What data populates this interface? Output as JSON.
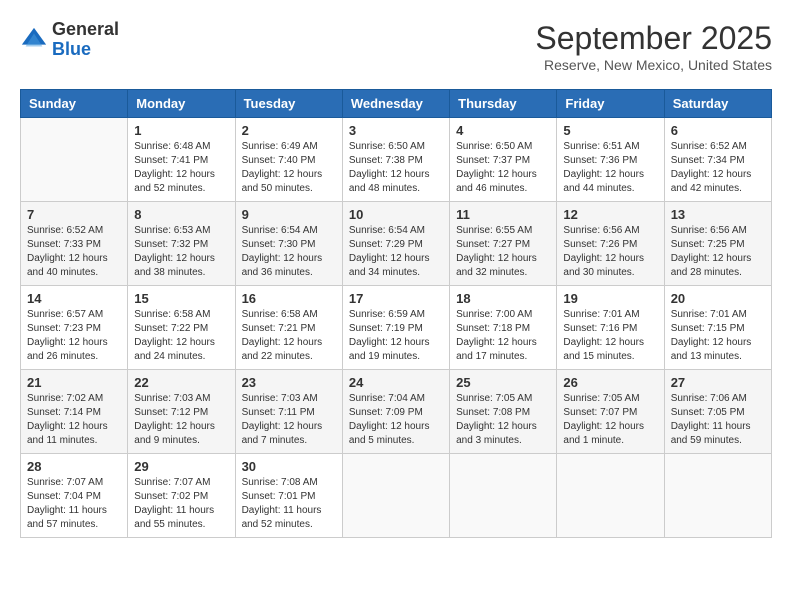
{
  "header": {
    "logo_general": "General",
    "logo_blue": "Blue",
    "month_title": "September 2025",
    "location": "Reserve, New Mexico, United States"
  },
  "days_of_week": [
    "Sunday",
    "Monday",
    "Tuesday",
    "Wednesday",
    "Thursday",
    "Friday",
    "Saturday"
  ],
  "weeks": [
    [
      {
        "day": "",
        "sunrise": "",
        "sunset": "",
        "daylight": ""
      },
      {
        "day": "1",
        "sunrise": "Sunrise: 6:48 AM",
        "sunset": "Sunset: 7:41 PM",
        "daylight": "Daylight: 12 hours and 52 minutes."
      },
      {
        "day": "2",
        "sunrise": "Sunrise: 6:49 AM",
        "sunset": "Sunset: 7:40 PM",
        "daylight": "Daylight: 12 hours and 50 minutes."
      },
      {
        "day": "3",
        "sunrise": "Sunrise: 6:50 AM",
        "sunset": "Sunset: 7:38 PM",
        "daylight": "Daylight: 12 hours and 48 minutes."
      },
      {
        "day": "4",
        "sunrise": "Sunrise: 6:50 AM",
        "sunset": "Sunset: 7:37 PM",
        "daylight": "Daylight: 12 hours and 46 minutes."
      },
      {
        "day": "5",
        "sunrise": "Sunrise: 6:51 AM",
        "sunset": "Sunset: 7:36 PM",
        "daylight": "Daylight: 12 hours and 44 minutes."
      },
      {
        "day": "6",
        "sunrise": "Sunrise: 6:52 AM",
        "sunset": "Sunset: 7:34 PM",
        "daylight": "Daylight: 12 hours and 42 minutes."
      }
    ],
    [
      {
        "day": "7",
        "sunrise": "Sunrise: 6:52 AM",
        "sunset": "Sunset: 7:33 PM",
        "daylight": "Daylight: 12 hours and 40 minutes."
      },
      {
        "day": "8",
        "sunrise": "Sunrise: 6:53 AM",
        "sunset": "Sunset: 7:32 PM",
        "daylight": "Daylight: 12 hours and 38 minutes."
      },
      {
        "day": "9",
        "sunrise": "Sunrise: 6:54 AM",
        "sunset": "Sunset: 7:30 PM",
        "daylight": "Daylight: 12 hours and 36 minutes."
      },
      {
        "day": "10",
        "sunrise": "Sunrise: 6:54 AM",
        "sunset": "Sunset: 7:29 PM",
        "daylight": "Daylight: 12 hours and 34 minutes."
      },
      {
        "day": "11",
        "sunrise": "Sunrise: 6:55 AM",
        "sunset": "Sunset: 7:27 PM",
        "daylight": "Daylight: 12 hours and 32 minutes."
      },
      {
        "day": "12",
        "sunrise": "Sunrise: 6:56 AM",
        "sunset": "Sunset: 7:26 PM",
        "daylight": "Daylight: 12 hours and 30 minutes."
      },
      {
        "day": "13",
        "sunrise": "Sunrise: 6:56 AM",
        "sunset": "Sunset: 7:25 PM",
        "daylight": "Daylight: 12 hours and 28 minutes."
      }
    ],
    [
      {
        "day": "14",
        "sunrise": "Sunrise: 6:57 AM",
        "sunset": "Sunset: 7:23 PM",
        "daylight": "Daylight: 12 hours and 26 minutes."
      },
      {
        "day": "15",
        "sunrise": "Sunrise: 6:58 AM",
        "sunset": "Sunset: 7:22 PM",
        "daylight": "Daylight: 12 hours and 24 minutes."
      },
      {
        "day": "16",
        "sunrise": "Sunrise: 6:58 AM",
        "sunset": "Sunset: 7:21 PM",
        "daylight": "Daylight: 12 hours and 22 minutes."
      },
      {
        "day": "17",
        "sunrise": "Sunrise: 6:59 AM",
        "sunset": "Sunset: 7:19 PM",
        "daylight": "Daylight: 12 hours and 19 minutes."
      },
      {
        "day": "18",
        "sunrise": "Sunrise: 7:00 AM",
        "sunset": "Sunset: 7:18 PM",
        "daylight": "Daylight: 12 hours and 17 minutes."
      },
      {
        "day": "19",
        "sunrise": "Sunrise: 7:01 AM",
        "sunset": "Sunset: 7:16 PM",
        "daylight": "Daylight: 12 hours and 15 minutes."
      },
      {
        "day": "20",
        "sunrise": "Sunrise: 7:01 AM",
        "sunset": "Sunset: 7:15 PM",
        "daylight": "Daylight: 12 hours and 13 minutes."
      }
    ],
    [
      {
        "day": "21",
        "sunrise": "Sunrise: 7:02 AM",
        "sunset": "Sunset: 7:14 PM",
        "daylight": "Daylight: 12 hours and 11 minutes."
      },
      {
        "day": "22",
        "sunrise": "Sunrise: 7:03 AM",
        "sunset": "Sunset: 7:12 PM",
        "daylight": "Daylight: 12 hours and 9 minutes."
      },
      {
        "day": "23",
        "sunrise": "Sunrise: 7:03 AM",
        "sunset": "Sunset: 7:11 PM",
        "daylight": "Daylight: 12 hours and 7 minutes."
      },
      {
        "day": "24",
        "sunrise": "Sunrise: 7:04 AM",
        "sunset": "Sunset: 7:09 PM",
        "daylight": "Daylight: 12 hours and 5 minutes."
      },
      {
        "day": "25",
        "sunrise": "Sunrise: 7:05 AM",
        "sunset": "Sunset: 7:08 PM",
        "daylight": "Daylight: 12 hours and 3 minutes."
      },
      {
        "day": "26",
        "sunrise": "Sunrise: 7:05 AM",
        "sunset": "Sunset: 7:07 PM",
        "daylight": "Daylight: 12 hours and 1 minute."
      },
      {
        "day": "27",
        "sunrise": "Sunrise: 7:06 AM",
        "sunset": "Sunset: 7:05 PM",
        "daylight": "Daylight: 11 hours and 59 minutes."
      }
    ],
    [
      {
        "day": "28",
        "sunrise": "Sunrise: 7:07 AM",
        "sunset": "Sunset: 7:04 PM",
        "daylight": "Daylight: 11 hours and 57 minutes."
      },
      {
        "day": "29",
        "sunrise": "Sunrise: 7:07 AM",
        "sunset": "Sunset: 7:02 PM",
        "daylight": "Daylight: 11 hours and 55 minutes."
      },
      {
        "day": "30",
        "sunrise": "Sunrise: 7:08 AM",
        "sunset": "Sunset: 7:01 PM",
        "daylight": "Daylight: 11 hours and 52 minutes."
      },
      {
        "day": "",
        "sunrise": "",
        "sunset": "",
        "daylight": ""
      },
      {
        "day": "",
        "sunrise": "",
        "sunset": "",
        "daylight": ""
      },
      {
        "day": "",
        "sunrise": "",
        "sunset": "",
        "daylight": ""
      },
      {
        "day": "",
        "sunrise": "",
        "sunset": "",
        "daylight": ""
      }
    ]
  ]
}
